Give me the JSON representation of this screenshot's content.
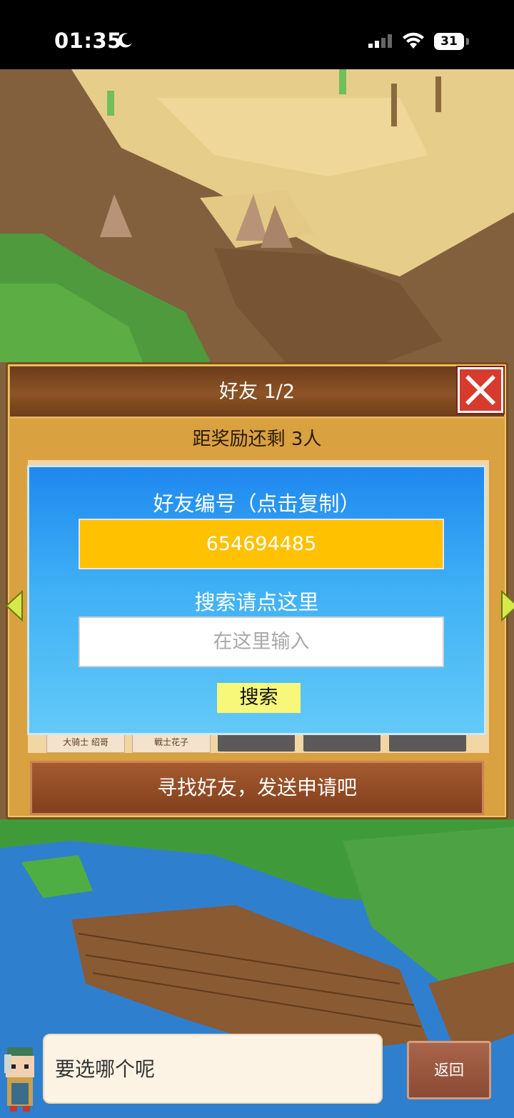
{
  "status_bar": {
    "time": "01:35",
    "battery": "31"
  },
  "dialog": {
    "title": "好友    1/2",
    "reward_text": "距奖励还剩 3人",
    "friend_slots": [
      "大骑士 绍哥",
      "戦士花子"
    ],
    "find_button": "寻找好友，发送申请吧"
  },
  "friend_code_panel": {
    "title": "好友编号（点击复制）",
    "friend_id": "654694485",
    "search_label": "搜索请点这里",
    "search_placeholder": "在这里输入",
    "search_button": "搜索"
  },
  "bottom": {
    "speech_text": "要选哪个呢",
    "back_button": "返回"
  },
  "colors": {
    "overlay_blue": "#1e88ef",
    "id_box_yellow": "#ffc100",
    "find_button_brown": "#8a4a22",
    "close_red": "#d63b2e"
  },
  "icons": [
    "moon-icon",
    "signal-icon",
    "wifi-icon",
    "battery-icon",
    "close-icon",
    "left-arrow-icon",
    "right-arrow-icon",
    "avatar-icon"
  ]
}
